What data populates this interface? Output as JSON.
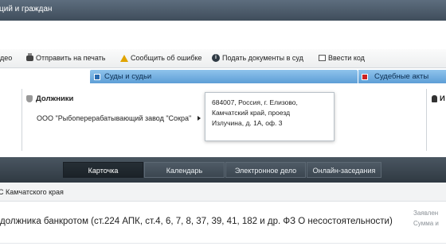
{
  "title_bar": {
    "text": "ций и граждан"
  },
  "toolbar": {
    "video_label": "део",
    "print_label": "Отправить на печать",
    "report_error_label": "Сообщить об ошибке",
    "submit_docs_label": "Подать документы в суд",
    "enter_code_label": "Ввести код",
    "icons": [
      "printer-icon",
      "warning-icon",
      "info-icon",
      "code-icon"
    ]
  },
  "section_tabs": {
    "courts_label": "Суды и судьи",
    "acts_label": "Судебные акты"
  },
  "participants": {
    "debtors_heading": "Должники",
    "debtor_name": "ООО \"Рыбоперерабатывающий завод \"Сокра\"",
    "right_heading": "И"
  },
  "tooltip": {
    "line1": "684007, Россия, г. Елизово,",
    "line2": "Камчатский край, проезд",
    "line3": "Излучина, д. 1А, оф. 3"
  },
  "nav": {
    "tabs": [
      {
        "label": "Карточка",
        "active": true
      },
      {
        "label": "Календарь",
        "active": false
      },
      {
        "label": "Электронное дело",
        "active": false
      },
      {
        "label": "Онлайн-заседания",
        "active": false
      }
    ]
  },
  "court_row": {
    "text": "С Камчатского края"
  },
  "case": {
    "description": "должника банкротом (ст.224 АПК, ст.4, 6, 7, 8, 37, 39, 41, 182 и др. ФЗ О несостоятельности)",
    "side_label1": "Заявлен",
    "side_label2": "Сумма и"
  },
  "colors": {
    "title_bar": "#4a5866",
    "tab_blue": "#6aa8dc",
    "nav_dark": "#2f3942",
    "active_nav": "#1b2228"
  }
}
